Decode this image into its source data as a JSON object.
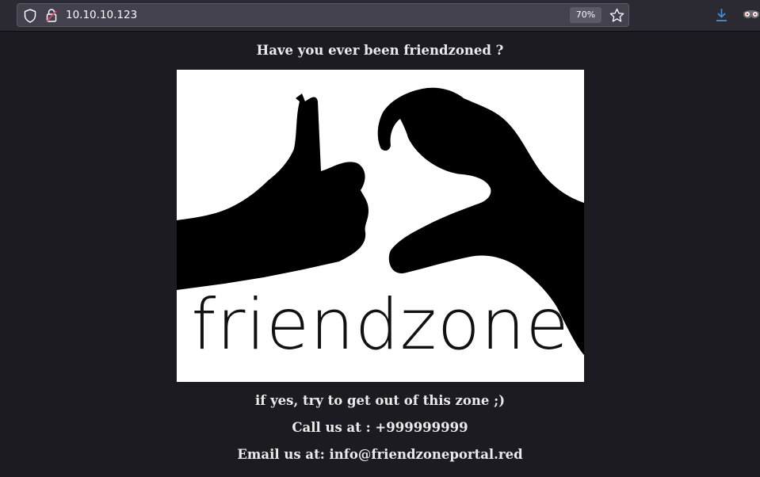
{
  "browser": {
    "url": "10.10.10.123",
    "zoom": "70%",
    "icons": {
      "shield": "shield-icon",
      "lock": "insecure-lock-icon",
      "star": "bookmark-star-icon",
      "download": "download-icon",
      "extension": "extension-mask-icon"
    }
  },
  "page": {
    "heading": "Have you ever been friendzoned ?",
    "image_word": "friendzone",
    "line_yes": "if yes, try to get out of this zone ;)",
    "line_call": "Call us at : +999999999",
    "line_email": "Email us at: info@friendzoneportal.red"
  },
  "colors": {
    "page_background": "#1c1b22",
    "toolbar_background": "#2b2a33",
    "text": "#ebebeb",
    "download_accent": "#4a90d9",
    "lock_accent": "#e2406c"
  }
}
